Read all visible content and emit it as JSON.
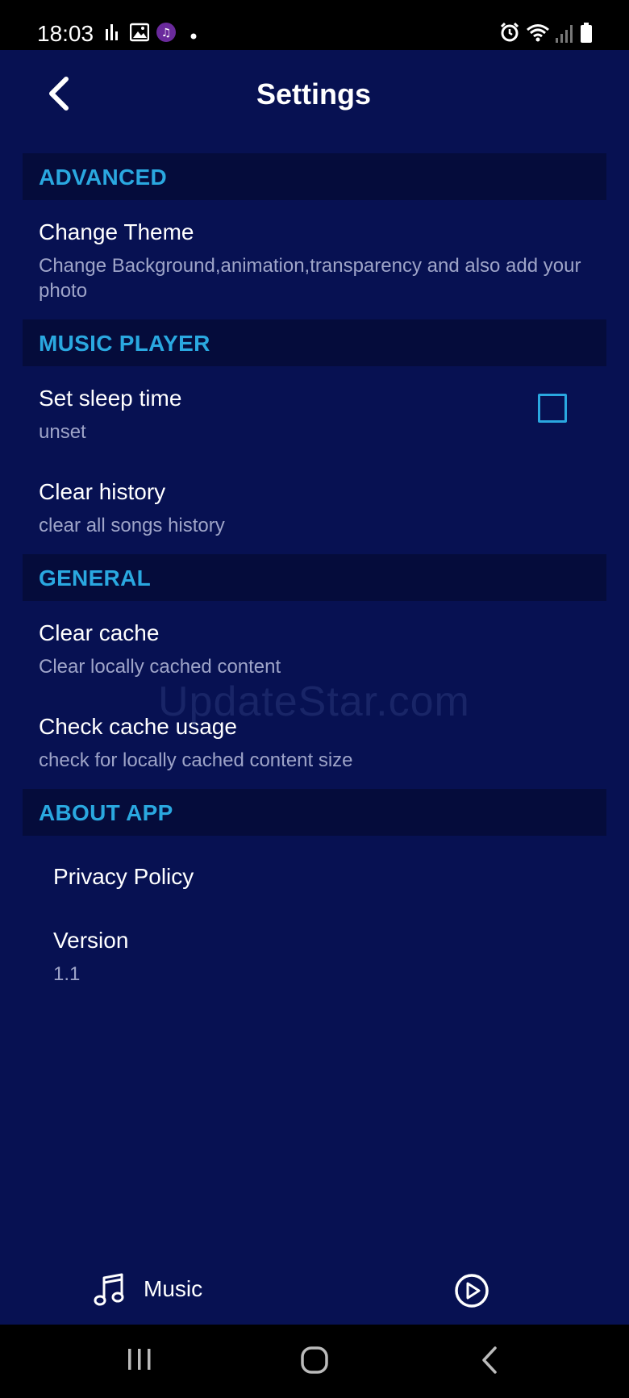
{
  "status_bar": {
    "time": "18:03"
  },
  "header": {
    "title": "Settings"
  },
  "sections": {
    "advanced": {
      "label": "ADVANCED",
      "change_theme": {
        "title": "Change Theme",
        "subtitle": "Change Background,animation,transparency and also add your photo"
      }
    },
    "music_player": {
      "label": "MUSIC PLAYER",
      "sleep_time": {
        "title": "Set sleep time",
        "subtitle": "unset",
        "checked": false
      },
      "clear_history": {
        "title": "Clear history",
        "subtitle": "clear all songs history"
      }
    },
    "general": {
      "label": "GENERAL",
      "clear_cache": {
        "title": "Clear cache",
        "subtitle": "Clear locally cached content"
      },
      "cache_usage": {
        "title": "Check cache usage",
        "subtitle": "check for locally cached content size"
      }
    },
    "about_app": {
      "label": "ABOUT APP",
      "privacy_policy": {
        "title": "Privacy Policy"
      },
      "version": {
        "title": "Version",
        "subtitle": "1.1"
      }
    }
  },
  "watermark": "UpdateStar.com",
  "bottom_bar": {
    "music_label": "Music"
  },
  "colors": {
    "background": "#071152",
    "section_background": "#050c3b",
    "accent": "#2aa8e0",
    "subtitle": "#9ea4c8"
  },
  "icons": [
    "back-icon",
    "music-note-icon",
    "play-circle-icon",
    "recents-icon",
    "home-icon",
    "nav-back-icon",
    "alarm-icon",
    "wifi-icon",
    "signal-icon",
    "battery-icon"
  ]
}
